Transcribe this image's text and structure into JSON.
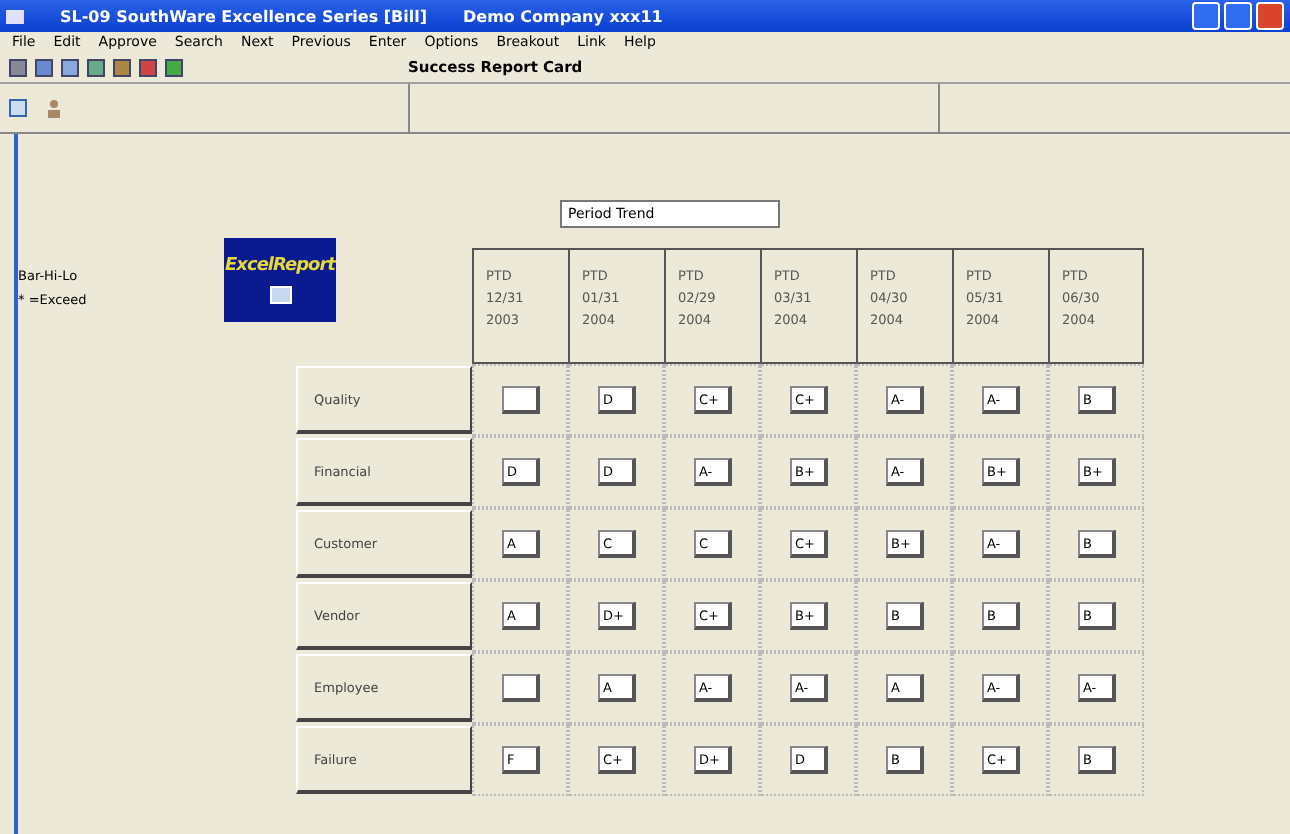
{
  "window": {
    "title": "SL-09   SouthWare Excellence Series [Bill]",
    "document": "Demo Company xxx11"
  },
  "menu": [
    "File",
    "Edit",
    "Approve",
    "Search",
    "Next",
    "Previous",
    "Enter",
    "Options",
    "Breakout",
    "Link",
    "Help"
  ],
  "toolbar": {
    "title": "Success Report Card"
  },
  "legend": [
    "Bar-Hi-Lo",
    "* =Exceed"
  ],
  "logo": {
    "text": "ExcelReport"
  },
  "view_field": {
    "value": "Period Trend"
  },
  "columns": [
    {
      "type": "PTD",
      "date": "12/31",
      "year": "2003"
    },
    {
      "type": "PTD",
      "date": "01/31",
      "year": "2004"
    },
    {
      "type": "PTD",
      "date": "02/29",
      "year": "2004"
    },
    {
      "type": "PTD",
      "date": "03/31",
      "year": "2004"
    },
    {
      "type": "PTD",
      "date": "04/30",
      "year": "2004"
    },
    {
      "type": "PTD",
      "date": "05/31",
      "year": "2004"
    },
    {
      "type": "PTD",
      "date": "06/30",
      "year": "2004"
    }
  ],
  "rows": [
    {
      "label": "Quality",
      "cells": [
        {},
        {
          "grade": "D"
        },
        {
          "grade": "C+"
        },
        {
          "grade": "C+"
        },
        {
          "grade": "A-"
        },
        {
          "grade": "A-"
        },
        {
          "grade": "B"
        }
      ]
    },
    {
      "label": "Financial",
      "cells": [
        {
          "grade": "D"
        },
        {
          "grade": "D"
        },
        {
          "grade": "A-"
        },
        {
          "grade": "B+"
        },
        {
          "grade": "A-"
        },
        {
          "grade": "B+"
        },
        {
          "grade": "B+"
        }
      ]
    },
    {
      "label": "Customer",
      "cells": [
        {
          "grade": "A"
        },
        {
          "grade": "C"
        },
        {
          "grade": "C"
        },
        {
          "grade": "C+"
        },
        {
          "grade": "B+"
        },
        {
          "grade": "A-"
        },
        {
          "grade": "B"
        }
      ]
    },
    {
      "label": "Vendor",
      "cells": [
        {
          "grade": "A"
        },
        {
          "grade": "D+"
        },
        {
          "grade": "C+"
        },
        {
          "grade": "B+"
        },
        {
          "grade": "B"
        },
        {
          "grade": "B"
        },
        {
          "grade": "B"
        }
      ]
    },
    {
      "label": "Employee",
      "cells": [
        {},
        {
          "grade": "A"
        },
        {
          "grade": "A-"
        },
        {
          "grade": "A-"
        },
        {
          "grade": "A"
        },
        {
          "grade": "A-"
        },
        {
          "grade": "A-"
        }
      ]
    },
    {
      "label": "Failure",
      "cells": [
        {
          "grade": "F"
        },
        {
          "grade": "C+"
        },
        {
          "grade": "D+"
        },
        {
          "grade": "D"
        },
        {
          "grade": "B"
        },
        {
          "grade": "C+"
        },
        {
          "grade": "B"
        }
      ]
    }
  ]
}
